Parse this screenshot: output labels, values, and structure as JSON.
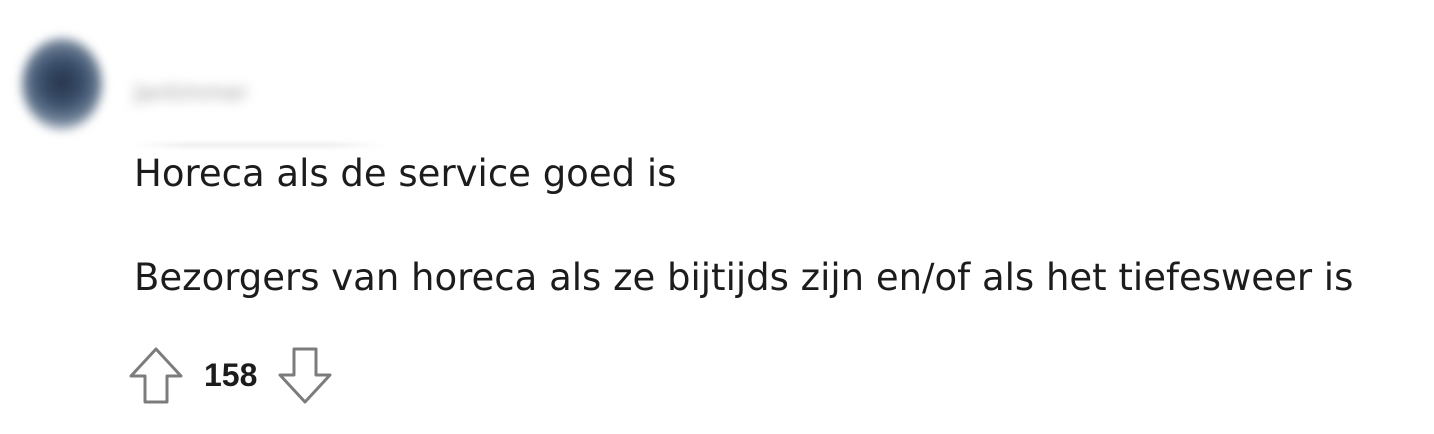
{
  "comment": {
    "author": "Jantimmer",
    "lines": [
      "Horeca als de service goed is",
      "Bezorgers van horeca als ze bijtijds zijn en/of als het tiefesweer is"
    ],
    "score": "158"
  },
  "icons": {
    "avatar": "user-avatar",
    "upvote": "arrow-up-outline-icon",
    "downvote": "arrow-down-outline-icon"
  }
}
